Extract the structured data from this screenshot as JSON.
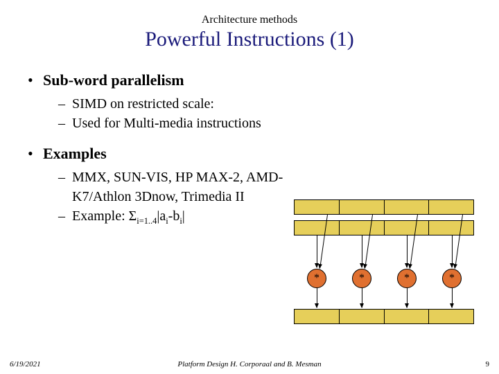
{
  "pretitle": "Architecture methods",
  "title": "Powerful Instructions (1)",
  "bullets": [
    {
      "label": "Sub-word parallelism",
      "sub": [
        "SIMD on restricted scale:",
        "Used for Multi-media instructions"
      ]
    },
    {
      "label": "Examples",
      "sub": [
        "MMX, SUN-VIS, HP MAX-2, AMD-K7/Athlon 3Dnow, Trimedia II",
        "__formula__"
      ]
    }
  ],
  "formula": {
    "prefix": "Example: ",
    "sigma": "Σ",
    "sub1": "i=1..4",
    "mid": "|a",
    "sub2": "i",
    "dash": "-b",
    "sub3": "i",
    "end": "|"
  },
  "op_symbol": "*",
  "footer": {
    "date": "6/19/2021",
    "center": "Platform Design     H. Corporaal and B. Mesman",
    "page": "9"
  }
}
